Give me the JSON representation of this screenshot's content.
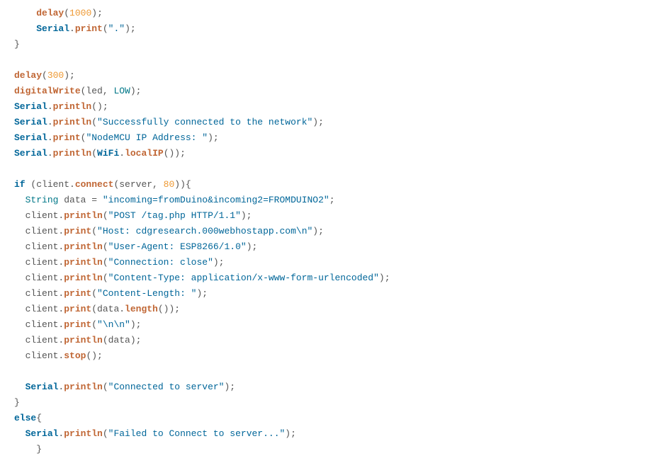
{
  "code": {
    "lines": [
      {
        "indent": 2,
        "tokens": [
          {
            "c": "hl",
            "t": "delay"
          },
          {
            "c": "plain",
            "t": "("
          },
          {
            "c": "num",
            "t": "1000"
          },
          {
            "c": "plain",
            "t": ");"
          }
        ]
      },
      {
        "indent": 2,
        "tokens": [
          {
            "c": "kw",
            "t": "Serial"
          },
          {
            "c": "plain",
            "t": "."
          },
          {
            "c": "hl",
            "t": "print"
          },
          {
            "c": "plain",
            "t": "("
          },
          {
            "c": "str",
            "t": "\".\""
          },
          {
            "c": "plain",
            "t": ");"
          }
        ]
      },
      {
        "indent": 0,
        "tokens": [
          {
            "c": "plain",
            "t": "}"
          }
        ]
      },
      {
        "indent": 0,
        "tokens": []
      },
      {
        "indent": 0,
        "tokens": [
          {
            "c": "hl",
            "t": "delay"
          },
          {
            "c": "plain",
            "t": "("
          },
          {
            "c": "num",
            "t": "300"
          },
          {
            "c": "plain",
            "t": ");"
          }
        ]
      },
      {
        "indent": 0,
        "tokens": [
          {
            "c": "hl",
            "t": "digitalWrite"
          },
          {
            "c": "plain",
            "t": "(led, "
          },
          {
            "c": "const",
            "t": "LOW"
          },
          {
            "c": "plain",
            "t": ");"
          }
        ]
      },
      {
        "indent": 0,
        "tokens": [
          {
            "c": "kw",
            "t": "Serial"
          },
          {
            "c": "plain",
            "t": "."
          },
          {
            "c": "hl",
            "t": "println"
          },
          {
            "c": "plain",
            "t": "();"
          }
        ]
      },
      {
        "indent": 0,
        "tokens": [
          {
            "c": "kw",
            "t": "Serial"
          },
          {
            "c": "plain",
            "t": "."
          },
          {
            "c": "hl",
            "t": "println"
          },
          {
            "c": "plain",
            "t": "("
          },
          {
            "c": "str",
            "t": "\"Successfully connected to the network\""
          },
          {
            "c": "plain",
            "t": ");"
          }
        ]
      },
      {
        "indent": 0,
        "tokens": [
          {
            "c": "kw",
            "t": "Serial"
          },
          {
            "c": "plain",
            "t": "."
          },
          {
            "c": "hl",
            "t": "print"
          },
          {
            "c": "plain",
            "t": "("
          },
          {
            "c": "str",
            "t": "\"NodeMCU IP Address: \""
          },
          {
            "c": "plain",
            "t": ");"
          }
        ]
      },
      {
        "indent": 0,
        "tokens": [
          {
            "c": "kw",
            "t": "Serial"
          },
          {
            "c": "plain",
            "t": "."
          },
          {
            "c": "hl",
            "t": "println"
          },
          {
            "c": "plain",
            "t": "("
          },
          {
            "c": "kw",
            "t": "WiFi"
          },
          {
            "c": "plain",
            "t": "."
          },
          {
            "c": "hl",
            "t": "localIP"
          },
          {
            "c": "plain",
            "t": "());"
          }
        ]
      },
      {
        "indent": 0,
        "tokens": []
      },
      {
        "indent": 0,
        "tokens": [
          {
            "c": "kw",
            "t": "if"
          },
          {
            "c": "plain",
            "t": " (client."
          },
          {
            "c": "hl",
            "t": "connect"
          },
          {
            "c": "plain",
            "t": "(server, "
          },
          {
            "c": "num",
            "t": "80"
          },
          {
            "c": "plain",
            "t": ")){"
          }
        ]
      },
      {
        "indent": 1,
        "tokens": [
          {
            "c": "type",
            "t": "String"
          },
          {
            "c": "plain",
            "t": " data = "
          },
          {
            "c": "str",
            "t": "\"incoming=fromDuino&incoming2=FROMDUINO2\""
          },
          {
            "c": "plain",
            "t": ";"
          }
        ]
      },
      {
        "indent": 1,
        "tokens": [
          {
            "c": "plain",
            "t": "client."
          },
          {
            "c": "hl",
            "t": "println"
          },
          {
            "c": "plain",
            "t": "("
          },
          {
            "c": "str",
            "t": "\"POST /tag.php HTTP/1.1\""
          },
          {
            "c": "plain",
            "t": ");"
          }
        ]
      },
      {
        "indent": 1,
        "tokens": [
          {
            "c": "plain",
            "t": "client."
          },
          {
            "c": "hl",
            "t": "print"
          },
          {
            "c": "plain",
            "t": "("
          },
          {
            "c": "str",
            "t": "\"Host: cdgresearch.000webhostapp.com\\n\""
          },
          {
            "c": "plain",
            "t": ");"
          }
        ]
      },
      {
        "indent": 1,
        "tokens": [
          {
            "c": "plain",
            "t": "client."
          },
          {
            "c": "hl",
            "t": "println"
          },
          {
            "c": "plain",
            "t": "("
          },
          {
            "c": "str",
            "t": "\"User-Agent: ESP8266/1.0\""
          },
          {
            "c": "plain",
            "t": ");"
          }
        ]
      },
      {
        "indent": 1,
        "tokens": [
          {
            "c": "plain",
            "t": "client."
          },
          {
            "c": "hl",
            "t": "println"
          },
          {
            "c": "plain",
            "t": "("
          },
          {
            "c": "str",
            "t": "\"Connection: close\""
          },
          {
            "c": "plain",
            "t": ");"
          }
        ]
      },
      {
        "indent": 1,
        "tokens": [
          {
            "c": "plain",
            "t": "client."
          },
          {
            "c": "hl",
            "t": "println"
          },
          {
            "c": "plain",
            "t": "("
          },
          {
            "c": "str",
            "t": "\"Content-Type: application/x-www-form-urlencoded\""
          },
          {
            "c": "plain",
            "t": ");"
          }
        ]
      },
      {
        "indent": 1,
        "tokens": [
          {
            "c": "plain",
            "t": "client."
          },
          {
            "c": "hl",
            "t": "print"
          },
          {
            "c": "plain",
            "t": "("
          },
          {
            "c": "str",
            "t": "\"Content-Length: \""
          },
          {
            "c": "plain",
            "t": ");"
          }
        ]
      },
      {
        "indent": 1,
        "tokens": [
          {
            "c": "plain",
            "t": "client."
          },
          {
            "c": "hl",
            "t": "print"
          },
          {
            "c": "plain",
            "t": "(data."
          },
          {
            "c": "hl",
            "t": "length"
          },
          {
            "c": "plain",
            "t": "());"
          }
        ]
      },
      {
        "indent": 1,
        "tokens": [
          {
            "c": "plain",
            "t": "client."
          },
          {
            "c": "hl",
            "t": "print"
          },
          {
            "c": "plain",
            "t": "("
          },
          {
            "c": "str",
            "t": "\"\\n\\n\""
          },
          {
            "c": "plain",
            "t": ");"
          }
        ]
      },
      {
        "indent": 1,
        "tokens": [
          {
            "c": "plain",
            "t": "client."
          },
          {
            "c": "hl",
            "t": "println"
          },
          {
            "c": "plain",
            "t": "(data);"
          }
        ]
      },
      {
        "indent": 1,
        "tokens": [
          {
            "c": "plain",
            "t": "client."
          },
          {
            "c": "hl",
            "t": "stop"
          },
          {
            "c": "plain",
            "t": "();"
          }
        ]
      },
      {
        "indent": 0,
        "tokens": []
      },
      {
        "indent": 1,
        "tokens": [
          {
            "c": "kw",
            "t": "Serial"
          },
          {
            "c": "plain",
            "t": "."
          },
          {
            "c": "hl",
            "t": "println"
          },
          {
            "c": "plain",
            "t": "("
          },
          {
            "c": "str",
            "t": "\"Connected to server\""
          },
          {
            "c": "plain",
            "t": ");"
          }
        ]
      },
      {
        "indent": 0,
        "tokens": [
          {
            "c": "plain",
            "t": "}"
          }
        ]
      },
      {
        "indent": 0,
        "tokens": [
          {
            "c": "kw",
            "t": "else"
          },
          {
            "c": "plain",
            "t": "{"
          }
        ]
      },
      {
        "indent": 1,
        "tokens": [
          {
            "c": "kw",
            "t": "Serial"
          },
          {
            "c": "plain",
            "t": "."
          },
          {
            "c": "hl",
            "t": "println"
          },
          {
            "c": "plain",
            "t": "("
          },
          {
            "c": "str",
            "t": "\"Failed to Connect to server...\""
          },
          {
            "c": "plain",
            "t": ");"
          }
        ]
      },
      {
        "indent": 2,
        "tokens": [
          {
            "c": "plain",
            "t": "}"
          }
        ]
      }
    ]
  }
}
